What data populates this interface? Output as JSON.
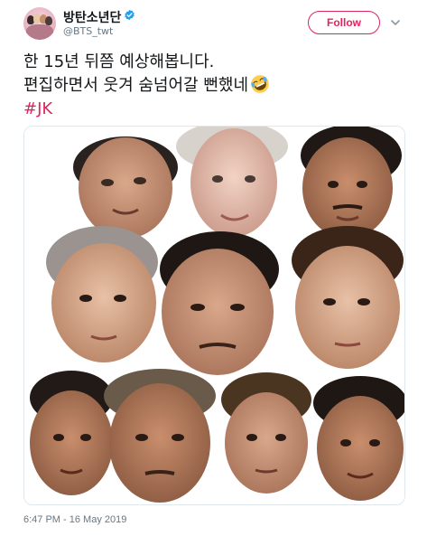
{
  "author": {
    "display_name": "방탄소년단",
    "handle": "@BTS_twt",
    "verified": true
  },
  "actions": {
    "follow_label": "Follow",
    "more_icon": "chevron-down-icon"
  },
  "tweet": {
    "line1": "한 15년 뒤쯤 예상해봅니다.",
    "line2": "편집하면서 웃겨 숨넘어갈 뻔했네",
    "line2_emoji": "rolling-on-floor-laughing-emoji",
    "hashtag": "#JK"
  },
  "media": {
    "description_icon": "photo-collage"
  },
  "meta": {
    "timestamp": "6:47 PM - 16 May 2019"
  },
  "colors": {
    "accent": "#e0245e",
    "verified_blue": "#1da1f2",
    "secondary_text": "#657786",
    "border": "#e1e8ed"
  }
}
